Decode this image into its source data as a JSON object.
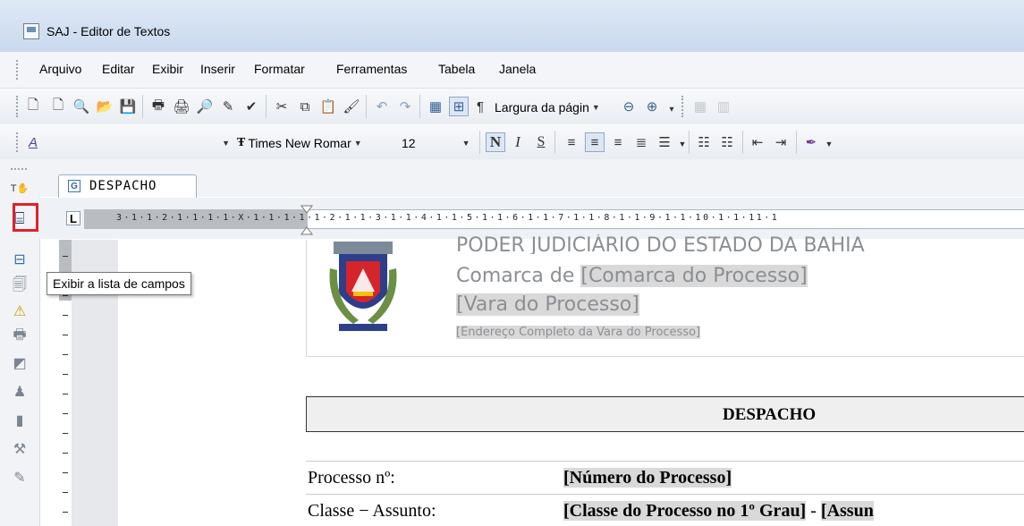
{
  "window": {
    "title": "SAJ - Editor de Textos"
  },
  "menubar": {
    "items": [
      {
        "label": "Arquivo"
      },
      {
        "label": "Editar"
      },
      {
        "label": "Exibir"
      },
      {
        "label": "Inserir"
      },
      {
        "label": "Formatar"
      },
      {
        "label": "Ferramentas"
      },
      {
        "label": "Tabela"
      },
      {
        "label": "Janela"
      }
    ]
  },
  "toolbar1": {
    "icons": [
      "new-document-icon",
      "blank-page-icon",
      "find-icon",
      "open-folder-icon",
      "save-icon",
      "print-icon",
      "print-preview-icon",
      "page-preview-icon",
      "spellcheck-icon",
      "abc-check-icon",
      "cut-icon",
      "copy-icon",
      "paste-icon",
      "format-painter-icon",
      "undo-icon",
      "redo-icon",
      "table-icon",
      "grid-icon",
      "pilcrow-icon",
      "zoom-out-icon",
      "zoom-in-icon"
    ],
    "zoom_value": "Largura da págin",
    "pilcrow": "¶"
  },
  "toolbar2": {
    "style_value": "",
    "font_value": "Times New Romar",
    "size_value": "12",
    "bold": "N",
    "italic": "I",
    "underline": "S"
  },
  "tabs": [
    {
      "label": "DESPACHO",
      "icon": "G"
    }
  ],
  "ruler": {
    "text": "3·1·1·2·1·1·1·1·X·1·1·1·1·1·2·1·1·3·1·1·4·1·1·5·1·1·6·1·1·7·1·1·8·1·1·9·1·1·10·1·1·11·1",
    "tab_stop": "L"
  },
  "tooltip": {
    "text": "Exibir a lista de campos"
  },
  "document": {
    "header": {
      "line1": "PODER JUDICIÁRIO DO ESTADO DA BAHIA",
      "comarca_prefix": "Comarca de ",
      "comarca_field": "[Comarca do Processo]",
      "vara_field": "[Vara do Processo]",
      "endereco_field": "[Endereço Completo da Vara do Processo]"
    },
    "title": "DESPACHO",
    "rows": [
      {
        "label": "Processo nº:",
        "value": "[Número do Processo]"
      },
      {
        "label": "Classe − Assunto:",
        "value": "[Classe do Processo no 1º Grau]",
        "suffix": " - ",
        "value2": "[Assun"
      }
    ]
  },
  "colors": {
    "highlight": "#e0202a",
    "field_bg": "#d9d9d9"
  }
}
